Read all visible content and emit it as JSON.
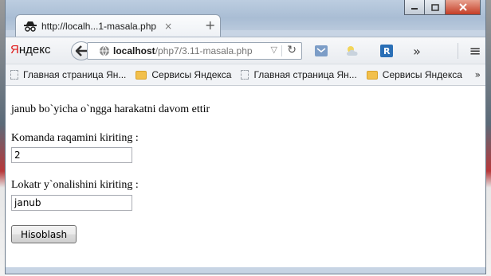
{
  "browser": {
    "tab_title": "http://localh...1-masala.php",
    "tab_close": "×",
    "new_tab": "+",
    "brand_first": "Я",
    "brand_rest": "ндекс",
    "url_host": "localhost",
    "url_path": "/php7/3.11-masala.php",
    "bookmarks": [
      {
        "label": "Главная страница Ян...",
        "icon": "page-icon"
      },
      {
        "label": "Сервисы Яндекса",
        "icon": "folder-icon"
      },
      {
        "label": "Главная страница Ян...",
        "icon": "page-icon"
      },
      {
        "label": "Сервисы Яндекса",
        "icon": "folder-icon"
      }
    ],
    "bookmarks_more": "»",
    "more_tools": "»",
    "menu": "≡"
  },
  "page": {
    "result_text": "janub bo`yicha o`ngga harakatni davom ettir",
    "command_label": "Komanda raqamini kiriting :",
    "command_value": "2",
    "direction_label": "Lokatr y`onalishini kiriting :",
    "direction_value": "janub",
    "submit_label": "Hisoblash"
  },
  "colors": {
    "yandex_red": "#e01b1b",
    "window_frame": "#c7d4e4"
  }
}
